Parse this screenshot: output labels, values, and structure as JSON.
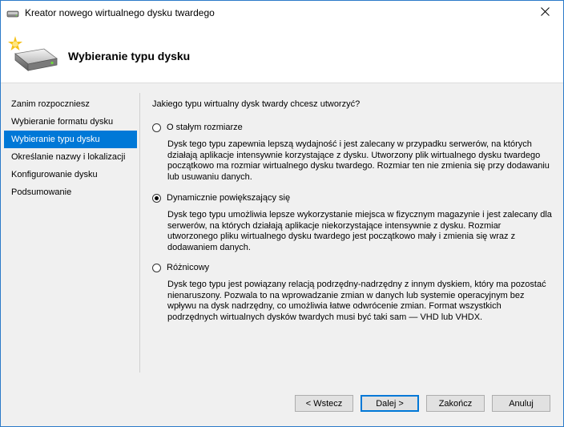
{
  "window": {
    "title": "Kreator nowego wirtualnego dysku twardego",
    "close_glyph": "✕"
  },
  "header": {
    "title": "Wybieranie typu dysku",
    "icon": "disk-wizard-icon"
  },
  "nav": {
    "items": [
      {
        "label": "Zanim rozpoczniesz",
        "active": false
      },
      {
        "label": "Wybieranie formatu dysku",
        "active": false
      },
      {
        "label": "Wybieranie typu dysku",
        "active": true
      },
      {
        "label": "Określanie nazwy i lokalizacji",
        "active": false
      },
      {
        "label": "Konfigurowanie dysku",
        "active": false
      },
      {
        "label": "Podsumowanie",
        "active": false
      }
    ]
  },
  "main": {
    "question": "Jakiego typu wirtualny dysk twardy chcesz utworzyć?",
    "options": [
      {
        "label": "O stałym rozmiarze",
        "selected": false,
        "description": "Dysk tego typu zapewnia lepszą wydajność i jest zalecany w przypadku serwerów, na których działają aplikacje intensywnie korzystające z dysku. Utworzony plik wirtualnego dysku twardego początkowo ma rozmiar wirtualnego dysku twardego. Rozmiar ten nie zmienia się przy dodawaniu lub usuwaniu danych."
      },
      {
        "label": "Dynamicznie powiększający się",
        "selected": true,
        "description": "Dysk tego typu umożliwia lepsze wykorzystanie miejsca w fizycznym magazynie i jest zalecany dla serwerów, na których działają aplikacje niekorzystające intensywnie z dysku. Rozmiar utworzonego pliku wirtualnego dysku twardego jest początkowo mały i zmienia się wraz z dodawaniem danych."
      },
      {
        "label": "Różnicowy",
        "selected": false,
        "description": "Dysk tego typu jest powiązany relacją podrzędny-nadrzędny z innym dyskiem, który ma pozostać nienaruszony. Pozwala to na wprowadzanie zmian w danych lub systemie operacyjnym bez wpływu na dysk nadrzędny, co umożliwia łatwe odwrócenie zmian. Format wszystkich podrzędnych wirtualnych dysków twardych musi być taki sam — VHD lub VHDX."
      }
    ]
  },
  "footer": {
    "back_label": "< Wstecz",
    "next_label": "Dalej >",
    "finish_label": "Zakończ",
    "cancel_label": "Anuluj"
  },
  "colors": {
    "accent": "#0078d7",
    "panel_bg": "#f0f0f0"
  }
}
